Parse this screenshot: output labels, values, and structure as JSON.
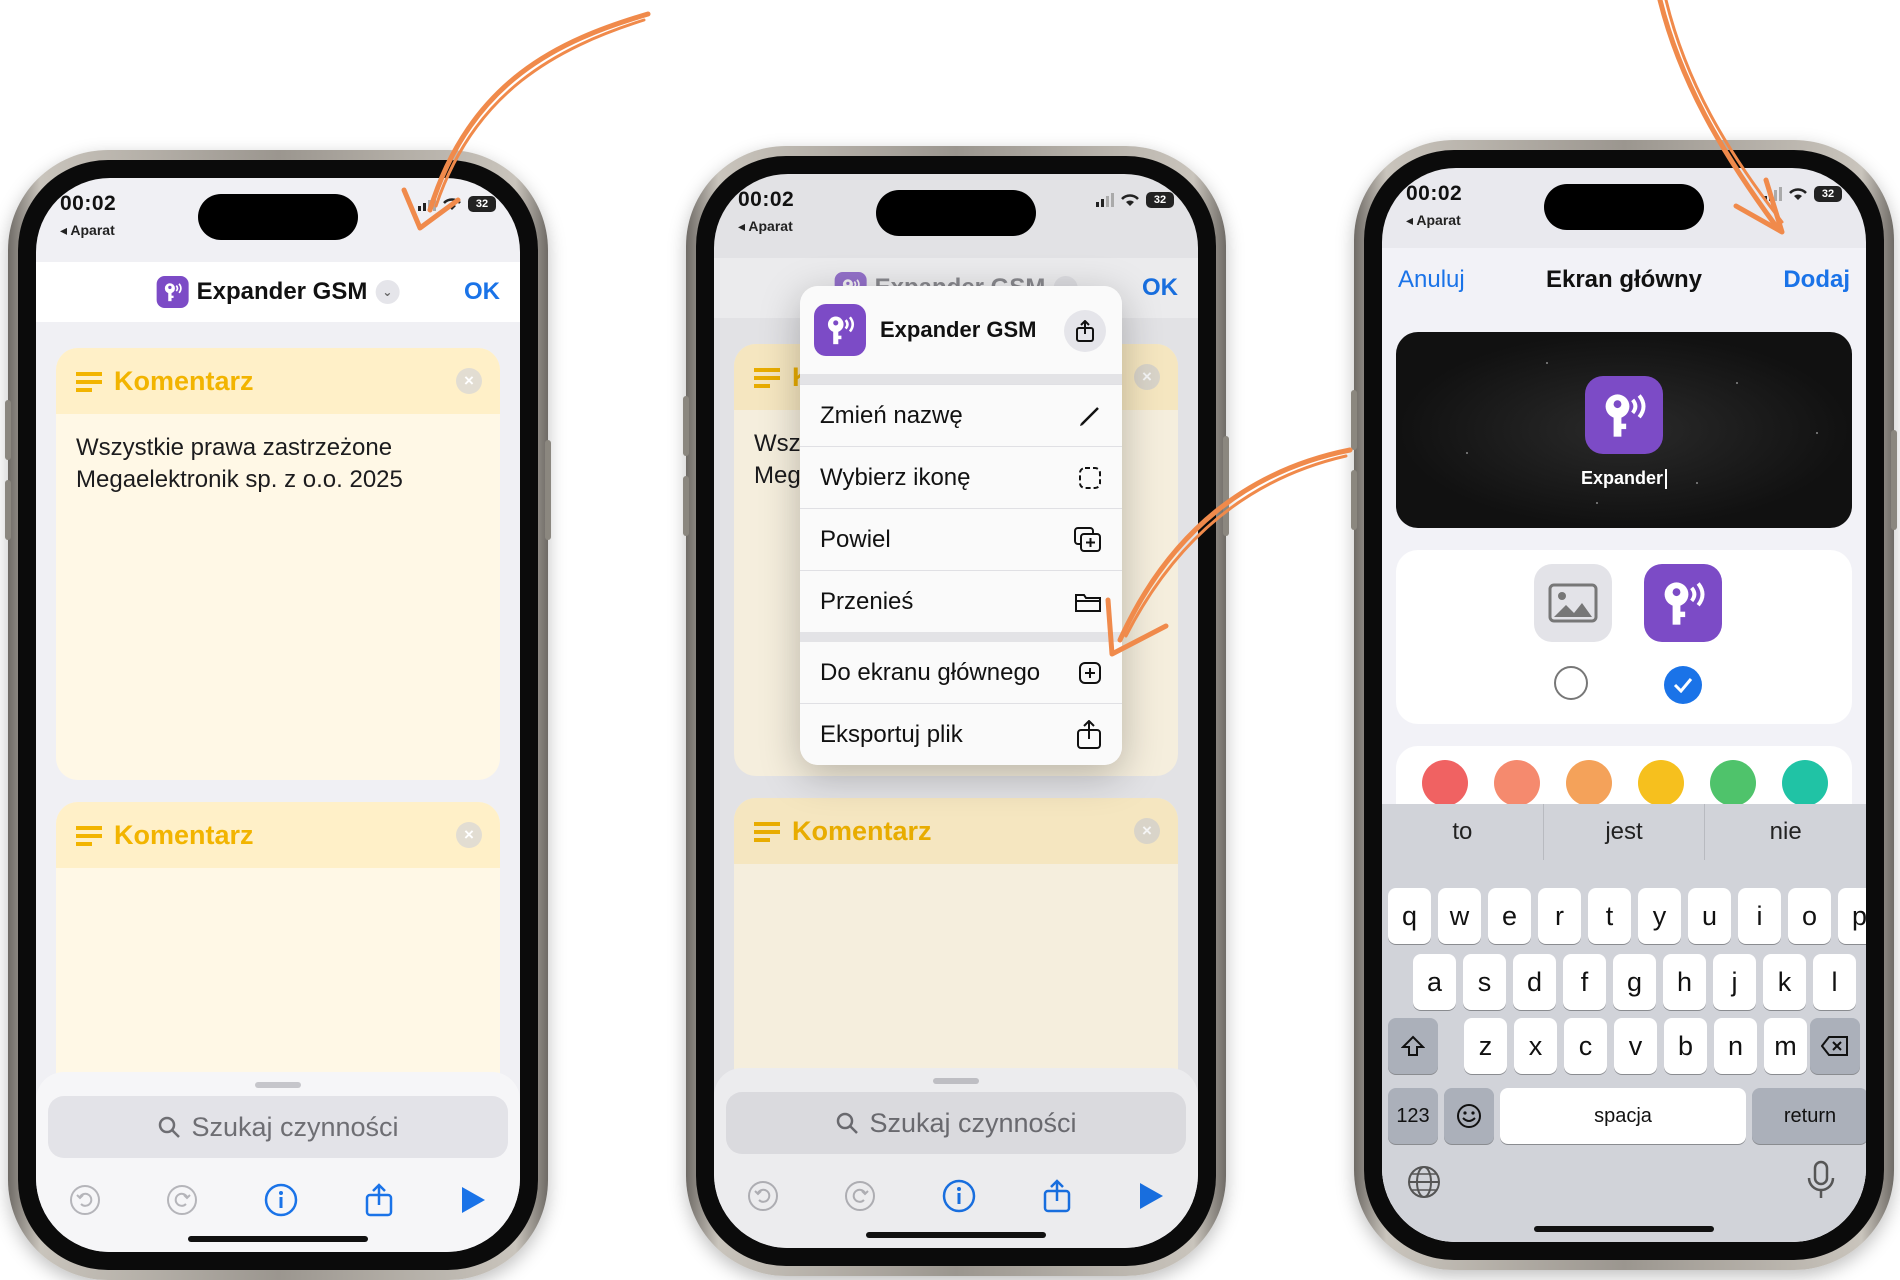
{
  "status": {
    "time": "00:02",
    "back_label": "◂ Aparat",
    "battery": "32"
  },
  "shortcut": {
    "name": "Expander GSM",
    "ok_label": "OK"
  },
  "editor": {
    "comment_label": "Komentarz",
    "comment_line1": "Wszystkie prawa zastrzeżone",
    "comment_line2": "Megaelektronik sp. z o.o. 2025",
    "search_placeholder": "Szukaj czynności"
  },
  "menu": {
    "items": [
      {
        "label": "Zmień nazwę",
        "icon": "pencil-icon"
      },
      {
        "label": "Wybierz ikonę",
        "icon": "dashed-square-icon"
      },
      {
        "label": "Powiel",
        "icon": "duplicate-icon"
      },
      {
        "label": "Przenieś",
        "icon": "folder-icon"
      },
      {
        "label": "Do ekranu głównego",
        "icon": "plus-square-icon"
      },
      {
        "label": "Eksportuj plik",
        "icon": "share-icon"
      }
    ],
    "peek_text_1": "Wsz",
    "peek_text_2": "Meg",
    "peek_label": "K"
  },
  "home_sheet": {
    "cancel_label": "Anuluj",
    "title": "Ekran główny",
    "add_label": "Dodaj",
    "app_label": "Expander",
    "colors": [
      "#f06262",
      "#f58a6e",
      "#f4a25a",
      "#f6c01e",
      "#4fc36b",
      "#20c3a5"
    ],
    "accent": "#7c4bc6"
  },
  "keyboard": {
    "suggestions": [
      "to",
      "jest",
      "nie"
    ],
    "row1": [
      "q",
      "w",
      "e",
      "r",
      "t",
      "y",
      "u",
      "i",
      "o",
      "p"
    ],
    "row2": [
      "a",
      "s",
      "d",
      "f",
      "g",
      "h",
      "j",
      "k",
      "l"
    ],
    "row3": [
      "z",
      "x",
      "c",
      "v",
      "b",
      "n",
      "m"
    ],
    "numbers_label": "123",
    "space_label": "spacja",
    "return_label": "return"
  }
}
